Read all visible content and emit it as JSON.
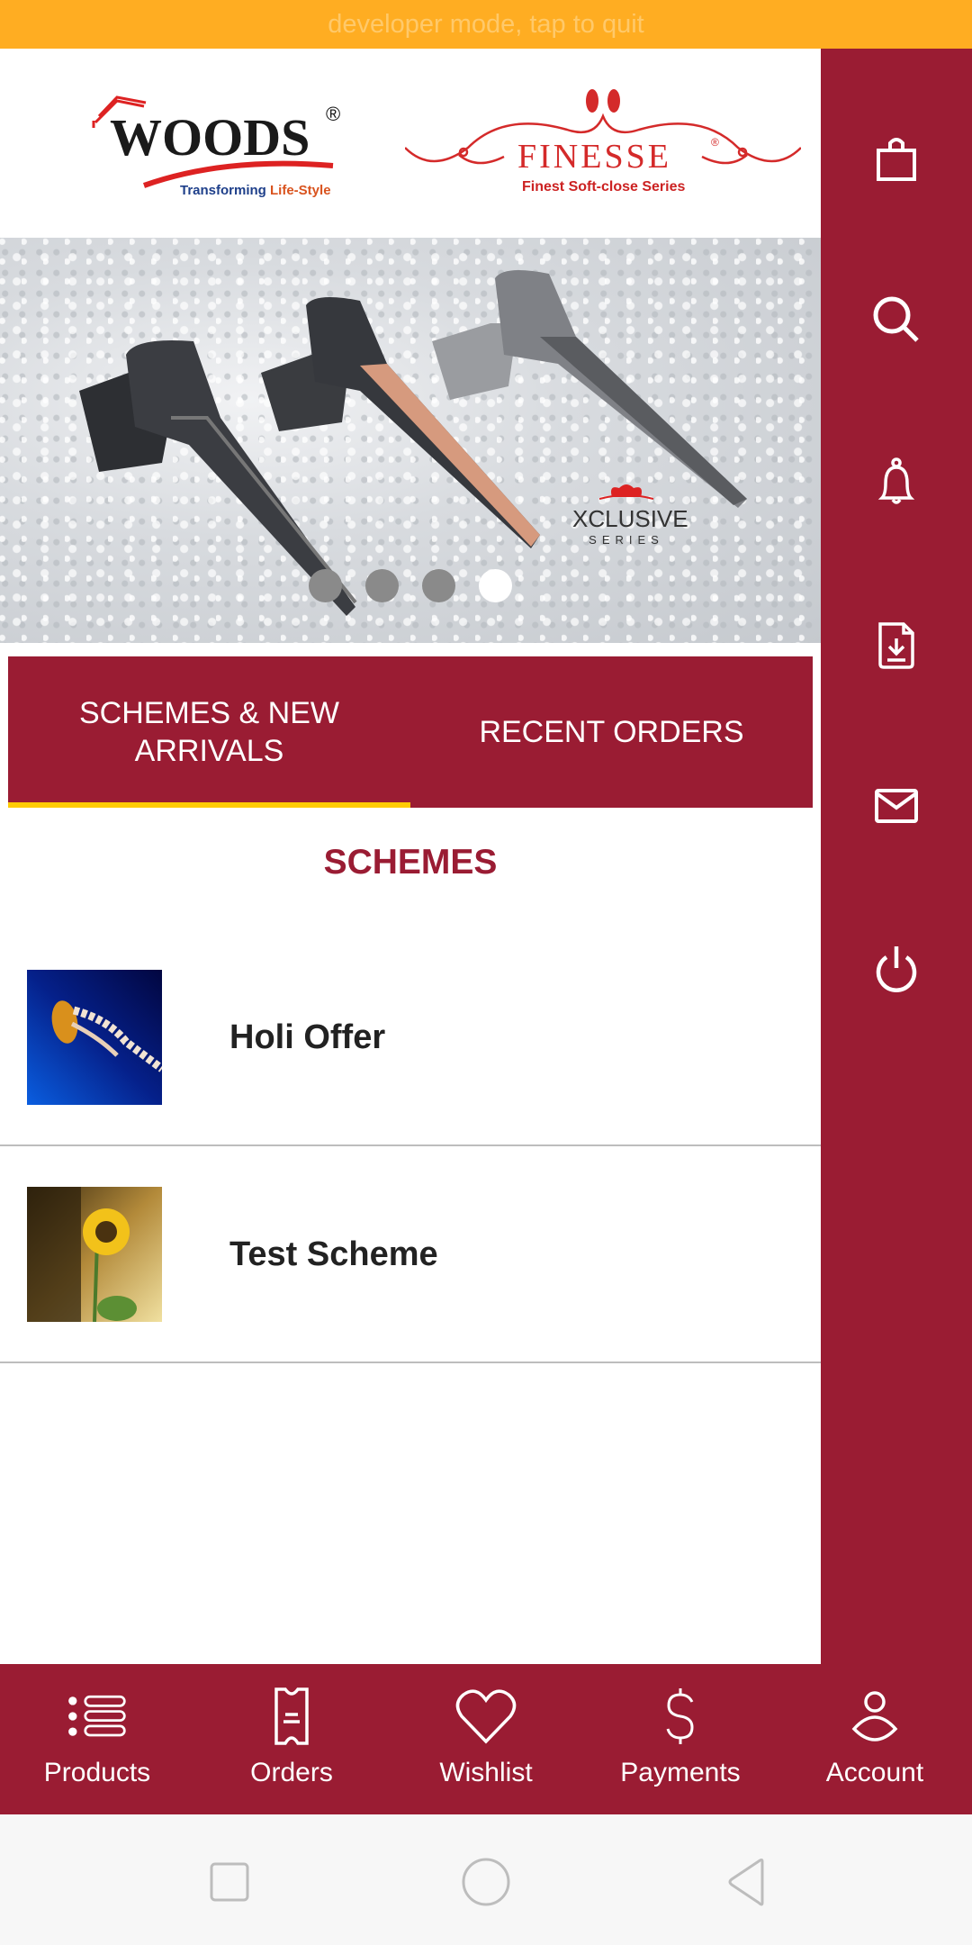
{
  "dev_banner": "developer mode, tap to quit",
  "logos": {
    "woods": {
      "name": "WOODS",
      "registered": "®",
      "tagline_a": "Transforming ",
      "tagline_b": "Life-Style"
    },
    "finesse": {
      "name": "FINESSE",
      "registered": "®",
      "tagline": "Finest Soft-close Series"
    }
  },
  "banner": {
    "badge_title": "XCLUSIVE",
    "badge_sub": "SERIES",
    "slides": 4,
    "active_slide": 4
  },
  "sidebar": {
    "items": [
      {
        "icon": "shopping-bag-icon",
        "label": "Cart"
      },
      {
        "icon": "search-icon",
        "label": "Search"
      },
      {
        "icon": "bell-icon",
        "label": "Notifications"
      },
      {
        "icon": "file-download-icon",
        "label": "Downloads"
      },
      {
        "icon": "mail-icon",
        "label": "Messages"
      },
      {
        "icon": "power-icon",
        "label": "Logout"
      }
    ]
  },
  "tabs": [
    {
      "label": "SCHEMES & NEW ARRIVALS",
      "active": true
    },
    {
      "label": "RECENT ORDERS",
      "active": false
    }
  ],
  "section_title": "SCHEMES",
  "schemes": [
    {
      "title": "Holi Offer",
      "image": "jellyfish"
    },
    {
      "title": "Test Scheme",
      "image": "sunflower"
    }
  ],
  "bottom_nav": [
    {
      "label": "Products",
      "icon": "list-icon"
    },
    {
      "label": "Orders",
      "icon": "receipt-icon"
    },
    {
      "label": "Wishlist",
      "icon": "heart-icon"
    },
    {
      "label": "Payments",
      "icon": "dollar-icon"
    },
    {
      "label": "Account",
      "icon": "user-icon"
    }
  ],
  "colors": {
    "primary": "#9A1C33",
    "dev_bar": "#FFAD22",
    "tab_indicator": "#FFCB05"
  }
}
